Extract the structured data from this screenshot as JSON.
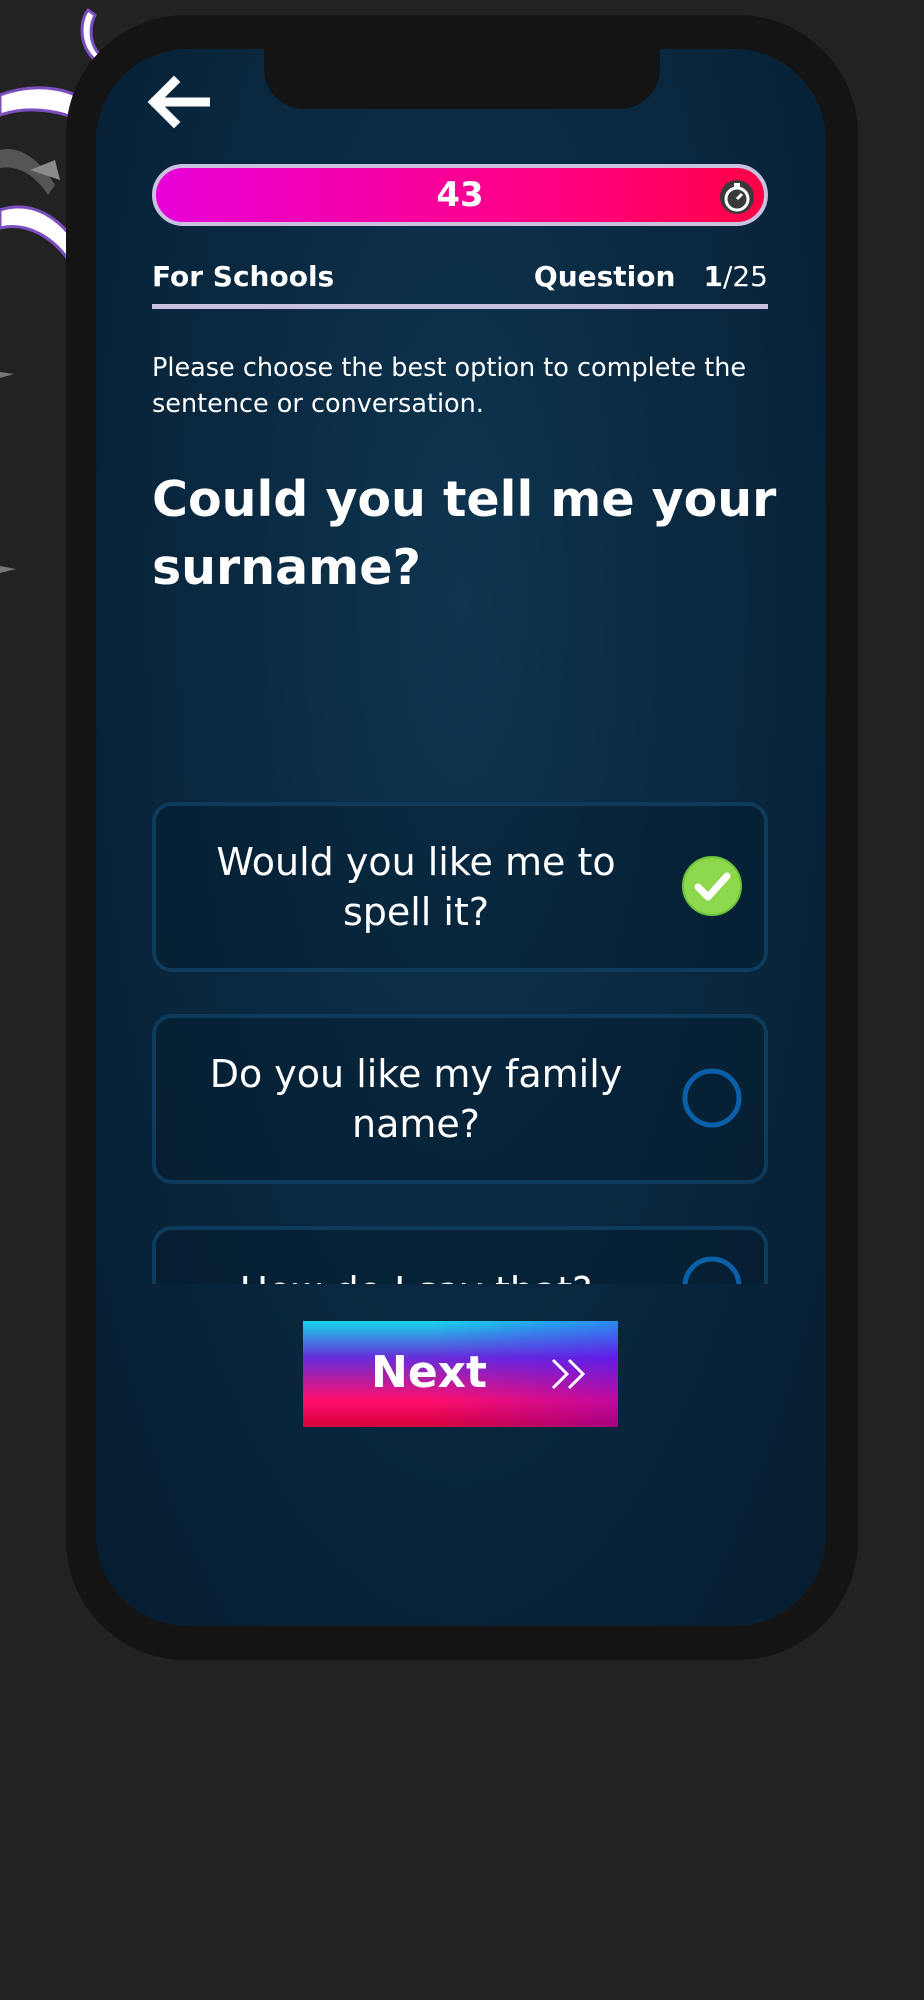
{
  "header": {
    "back_icon": "arrow-left-icon",
    "timer": {
      "value": "43",
      "icon": "stopwatch-icon"
    },
    "exam_label": "For Schools",
    "question_label": "Question",
    "question_current": "1",
    "question_total": "/25"
  },
  "quiz": {
    "instruction": "Please choose the best option to complete the sentence or conversation.",
    "question": "Could you tell me your surname?",
    "options": [
      {
        "text": "Would you like me to spell it?",
        "selected": true
      },
      {
        "text": "Do you like my family name?",
        "selected": false
      },
      {
        "text": "How do I say that?",
        "selected": false
      }
    ]
  },
  "footer": {
    "next_label": "Next",
    "next_icon": "double-chevron-right-icon"
  },
  "colors": {
    "background": "#222222",
    "phone_frame": "#141414",
    "screen": "#0a2a42",
    "timer_gradient_start": "#e800d8",
    "timer_gradient_end": "#ff0045",
    "check_green": "#8ed84e",
    "radio_blue": "#0b5fa8",
    "option_border": "#0e3a5c"
  }
}
